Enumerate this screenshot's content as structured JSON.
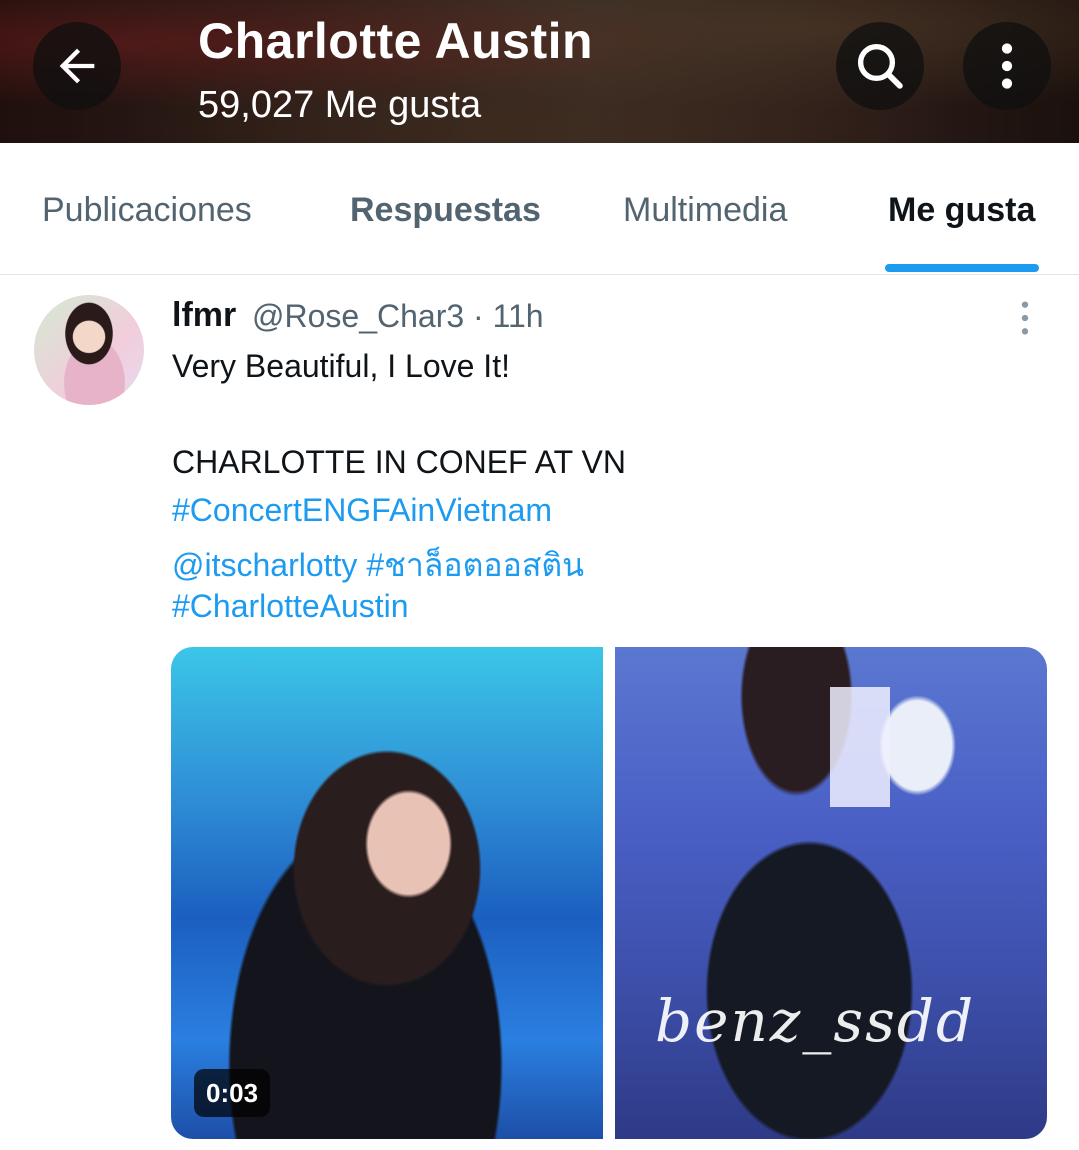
{
  "header": {
    "title": "Charlotte Austin",
    "subtitle": "59,027 Me gusta",
    "back_icon": "arrow-left-icon",
    "search_icon": "search-icon",
    "more_icon": "more-vertical-icon"
  },
  "tabs": [
    {
      "label": "Publicaciones",
      "selected": false
    },
    {
      "label": "Respuestas",
      "selected": false
    },
    {
      "label": "Multimedia",
      "selected": false
    },
    {
      "label": "Me gusta",
      "selected": true
    }
  ],
  "post": {
    "name": "lfmr",
    "handle_time": "@Rose_Char3 · 11h",
    "text_line1": "Very Beautiful, I Love It!",
    "text_line2": "CHARLOTTE IN CONEF AT VN",
    "hashtag1": "#ConcertENGFAinVietnam",
    "mention": "@itscharlotty",
    "hashtag2": "#ชาล็อตออสติน",
    "hashtag3": "#CharlotteAustin",
    "video_duration": "0:03",
    "watermark": "benz_ssdd"
  },
  "colors": {
    "accent": "#1d9bf0",
    "text_primary": "#0f1419",
    "text_secondary": "#536471"
  }
}
